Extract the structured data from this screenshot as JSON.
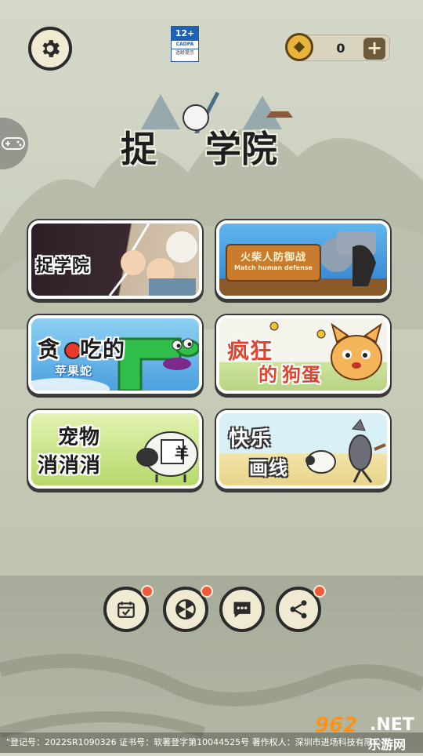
{
  "age_badge": {
    "rating": "12+",
    "org": "CADPA",
    "label": "适龄提示"
  },
  "coins": {
    "value": "0",
    "add_label": "+"
  },
  "logo": {
    "char1": "捉",
    "char2": "学院"
  },
  "games": [
    {
      "title": "捉学院",
      "colors": {
        "bg1": "#2b2026",
        "bg2": "#c9b7a0"
      }
    },
    {
      "title": "火柴人防御战",
      "subtitle": "Match human defense",
      "colors": {
        "bg1": "#5fb6ec",
        "bg2": "#2f7fd0"
      }
    },
    {
      "title_part1": "贪",
      "title_part2": "吃的",
      "title_part3": "苹果蛇",
      "colors": {
        "bg1": "#8fd0f2",
        "bg2": "#4aa0e0"
      }
    },
    {
      "title_part1": "疯狂",
      "title_part2": "的",
      "title_part3": "狗蛋",
      "colors": {
        "bg1": "#f4f4ec",
        "bg2": "#cde39d"
      }
    },
    {
      "title_line1": "宠物",
      "title_line2": "消消消",
      "sheep_char": "羊",
      "colors": {
        "bg1": "#e2f2b2",
        "bg2": "#b6d96a"
      }
    },
    {
      "title_line1": "快乐",
      "title_line2": "画线",
      "colors": {
        "bg1": "#d9f0f7",
        "bg2": "#f2e4a8"
      }
    }
  ],
  "footer": {
    "text": "\"登记号：2022SR1090326 证书号：软著登字第10044525号 著作权人：深圳市进场科技有限公司"
  },
  "watermark": {
    "num": "962",
    "net": ".NET",
    "cn": "乐游网"
  },
  "colors": {
    "accent": "#ef5a3a",
    "coin": "#e8b43a",
    "outline": "#2b2b2b",
    "button_face": "#f1ead2"
  }
}
